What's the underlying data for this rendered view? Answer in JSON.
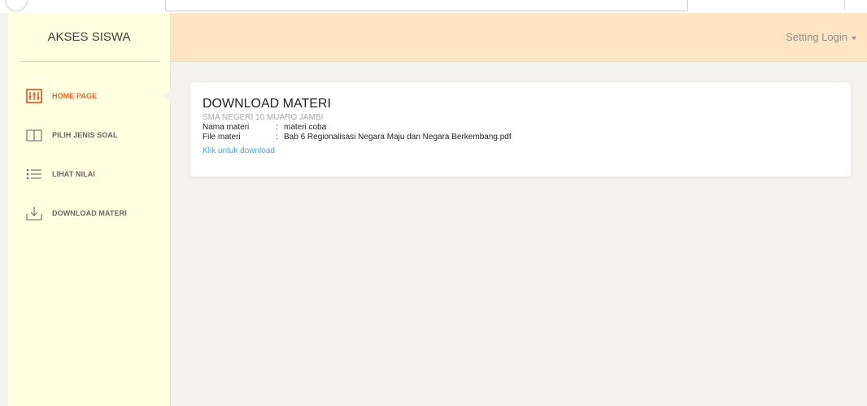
{
  "brand": {
    "title": "AKSES SISWA"
  },
  "sidebar": {
    "items": [
      {
        "label": "HOME PAGE",
        "icon": "home-icon",
        "active": true
      },
      {
        "label": "PILIH JENIS SOAL",
        "icon": "book-icon",
        "active": false
      },
      {
        "label": "LIHAT NILAI",
        "icon": "list-icon",
        "active": false
      },
      {
        "label": "DOWNLOAD MATERI",
        "icon": "download-icon",
        "active": false
      }
    ]
  },
  "topbar": {
    "setting_label": "Setting Login"
  },
  "card": {
    "title": "DOWNLOAD MATERI",
    "subtitle": "SMA NEGERI 10 MUARO JAMBI",
    "rows": [
      {
        "key": "Nama materi",
        "sep": ":",
        "value": "materi coba"
      },
      {
        "key": "File materi",
        "sep": ":",
        "value": "Bab 6 Regionalisasi Negara Maju dan Negara Berkembang.pdf"
      }
    ],
    "download_link": "Klik untuk download"
  },
  "colors": {
    "sidebar_bg": "#ffffe0",
    "topbar_bg": "#ffe5c4",
    "accent": "#e8642c",
    "link": "#4aa8cf",
    "page_bg": "#f3f2ef"
  }
}
